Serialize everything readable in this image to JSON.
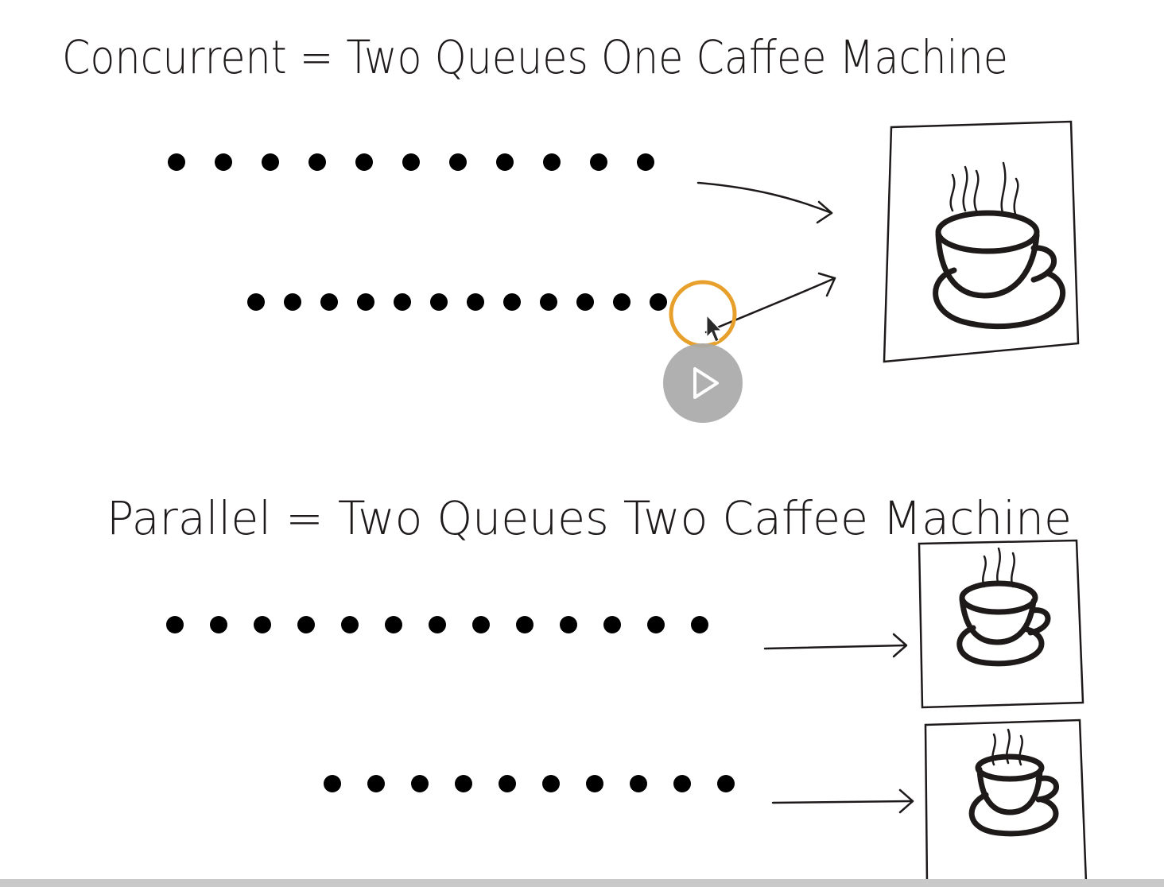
{
  "diagram": {
    "concurrent_heading": "Concurrent = Two Queues One Caffee Machine",
    "parallel_heading": "Parallel = Two Queues Two Caffee Machine"
  },
  "colors": {
    "ink": "#1e1a1a",
    "cursor_highlight": "#e8a02c",
    "play_button": "#a9a9a9"
  },
  "icons": [
    "stick-figure-icon",
    "coffee-cup-icon",
    "arrow-icon",
    "play-icon",
    "mouse-cursor-icon"
  ],
  "player": {
    "state": "paused"
  }
}
